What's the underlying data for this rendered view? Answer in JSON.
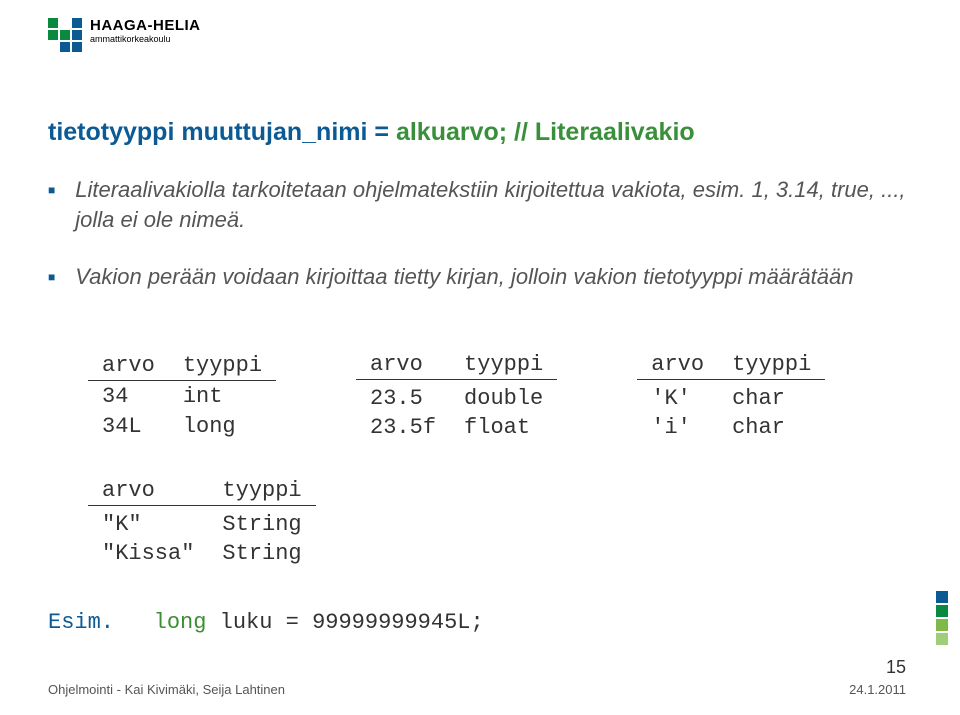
{
  "logo": {
    "name": "HAAGA-HELIA",
    "sub": "ammattikorkeakoulu"
  },
  "title": {
    "part1": "tietotyyppi muuttujan_nimi = ",
    "part2_green": "alkuarvo; // Literaalivakio"
  },
  "bullets": [
    "Literaalivakiolla tarkoitetaan ohjelmatekstiin kirjoitettua vakiota, esim. 1, 3.14, true, ..., jolla ei ole nimeä.",
    "Vakion perään voidaan kirjoittaa tietty kirjan, jolloin vakion tietotyyppi määrätään"
  ],
  "table1": {
    "head": [
      "arvo",
      "tyyppi"
    ],
    "rows": [
      [
        "34",
        "int"
      ],
      [
        "34L",
        "long"
      ]
    ]
  },
  "table2": {
    "head": [
      "arvo",
      "tyyppi"
    ],
    "rows": [
      [
        "23.5",
        "double"
      ],
      [
        "23.5f",
        "float"
      ]
    ]
  },
  "table3": {
    "head": [
      "arvo",
      "tyyppi"
    ],
    "rows": [
      [
        "'K'",
        "char"
      ],
      [
        "'i'",
        "char"
      ]
    ]
  },
  "table4": {
    "head": [
      "arvo",
      "tyyppi"
    ],
    "rows": [
      [
        "\"K\"",
        "String"
      ],
      [
        "\"Kissa\"",
        "String"
      ]
    ]
  },
  "example": {
    "label": "Esim.",
    "kw": "long",
    "rest1": " luku = ",
    "rest2": "99999999945L",
    "rest3": ";"
  },
  "footer": {
    "left": "Ohjelmointi - Kai Kivimäki, Seija Lahtinen",
    "num": "15",
    "date": "24.1.2011"
  }
}
